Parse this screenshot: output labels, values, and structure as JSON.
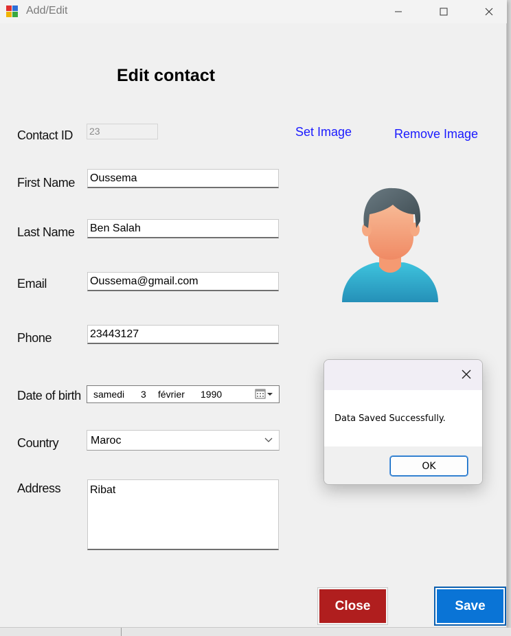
{
  "window": {
    "title": "Add/Edit",
    "minimize_icon": "minimize-icon",
    "maximize_icon": "maximize-icon",
    "close_icon": "close-icon"
  },
  "form": {
    "heading": "Edit contact",
    "contact_id_label": "Contact ID",
    "contact_id_value": "23",
    "first_name_label": "First Name",
    "first_name_value": "Oussema",
    "last_name_label": "Last Name",
    "last_name_value": "Ben Salah",
    "email_label": "Email",
    "email_value": "Oussema@gmail.com",
    "phone_label": "Phone",
    "phone_value": "23443127",
    "dob_label": "Date of birth",
    "dob_weekday": "samedi",
    "dob_day": "3",
    "dob_month": "février",
    "dob_year": "1990",
    "country_label": "Country",
    "country_value": "Maroc",
    "address_label": "Address",
    "address_value": "Ribat"
  },
  "image": {
    "set_label": "Set Image",
    "remove_label": "Remove Image",
    "avatar_icon": "person-avatar-icon"
  },
  "buttons": {
    "close_label": "Close",
    "save_label": "Save",
    "close_color": "#b01e1e",
    "save_color": "#0a74d6"
  },
  "dialog": {
    "message": "Data Saved Successfully.",
    "ok_label": "OK"
  },
  "colors": {
    "link": "#1a1aff"
  }
}
